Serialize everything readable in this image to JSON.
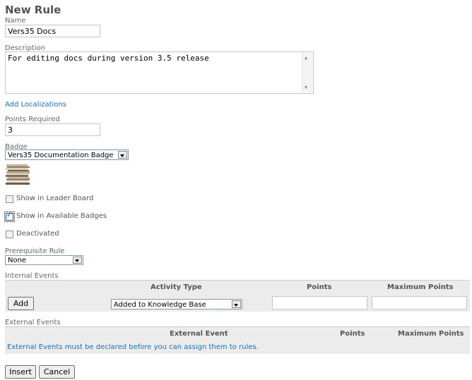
{
  "page": {
    "title": "New Rule"
  },
  "name": {
    "label": "Name",
    "value": "Vers35 Docs"
  },
  "description": {
    "label": "Description",
    "value": "For editing docs during version 3.5 release"
  },
  "localizations": {
    "link": "Add Localizations"
  },
  "points_required": {
    "label": "Points Required",
    "value": "3"
  },
  "badge": {
    "label": "Badge",
    "selected": "Vers35 Documentation Badge"
  },
  "checkboxes": {
    "leader_board": {
      "label": "Show in Leader Board",
      "checked": false
    },
    "available_badges": {
      "label": "Show in Available Badges",
      "checked": true
    },
    "deactivated": {
      "label": "Deactivated",
      "checked": false
    }
  },
  "prerequisite": {
    "label": "Prerequisite Rule",
    "selected": "None"
  },
  "internal_events": {
    "title": "Internal Events",
    "columns": [
      "Activity Type",
      "Points",
      "Maximum Points"
    ],
    "add_button": "Add",
    "activity_selected": "Added to Knowledge Base",
    "points_value": "",
    "max_points_value": ""
  },
  "external_events": {
    "title": "External Events",
    "columns": [
      "External Event",
      "Points",
      "Maximum Points"
    ],
    "message": "External Events must be declared before you can assign them to rules."
  },
  "actions": {
    "insert": "Insert",
    "cancel": "Cancel"
  },
  "colors": {
    "link": "#1a6fb5",
    "header_bg": "#ececec",
    "title": "#555555"
  }
}
